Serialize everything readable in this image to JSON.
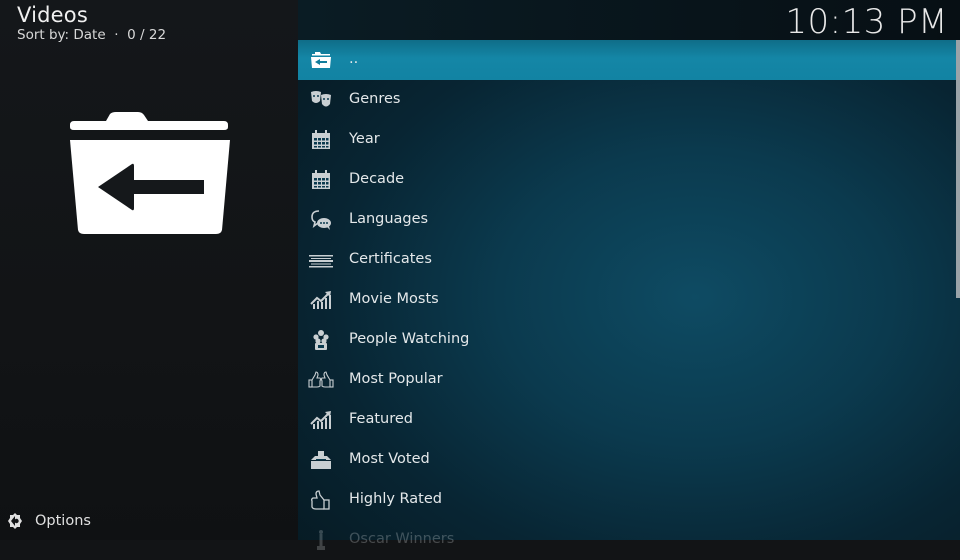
{
  "header": {
    "title": "Videos",
    "sort_label": "Sort by: Date",
    "separator": "·",
    "position": "0 / 22"
  },
  "clock": "10:13 PM",
  "preview_icon": "folder-back-icon",
  "options": {
    "label": "Options",
    "icon": "options-icon"
  },
  "list": {
    "focused_index": 0,
    "items": [
      {
        "label": "..",
        "icon": "folder-back-icon"
      },
      {
        "label": "Genres",
        "icon": "theater-masks-icon"
      },
      {
        "label": "Year",
        "icon": "calendar-icon"
      },
      {
        "label": "Decade",
        "icon": "calendar-icon"
      },
      {
        "label": "Languages",
        "icon": "speech-bubbles-icon"
      },
      {
        "label": "Certificates",
        "icon": "certificate-icon"
      },
      {
        "label": "Movie Mosts",
        "icon": "trending-chart-icon"
      },
      {
        "label": "People Watching",
        "icon": "people-icon"
      },
      {
        "label": "Most Popular",
        "icon": "thumbs-up-pair-icon"
      },
      {
        "label": "Featured",
        "icon": "trending-chart-icon"
      },
      {
        "label": "Most Voted",
        "icon": "ballot-box-icon"
      },
      {
        "label": "Highly Rated",
        "icon": "thumbs-up-icon"
      },
      {
        "label": "Oscar Winners",
        "icon": "trophy-icon"
      }
    ]
  },
  "colors": {
    "focus": "#1486a6",
    "left_panel": "#14171a",
    "right_panel": "#0b3a4e"
  }
}
